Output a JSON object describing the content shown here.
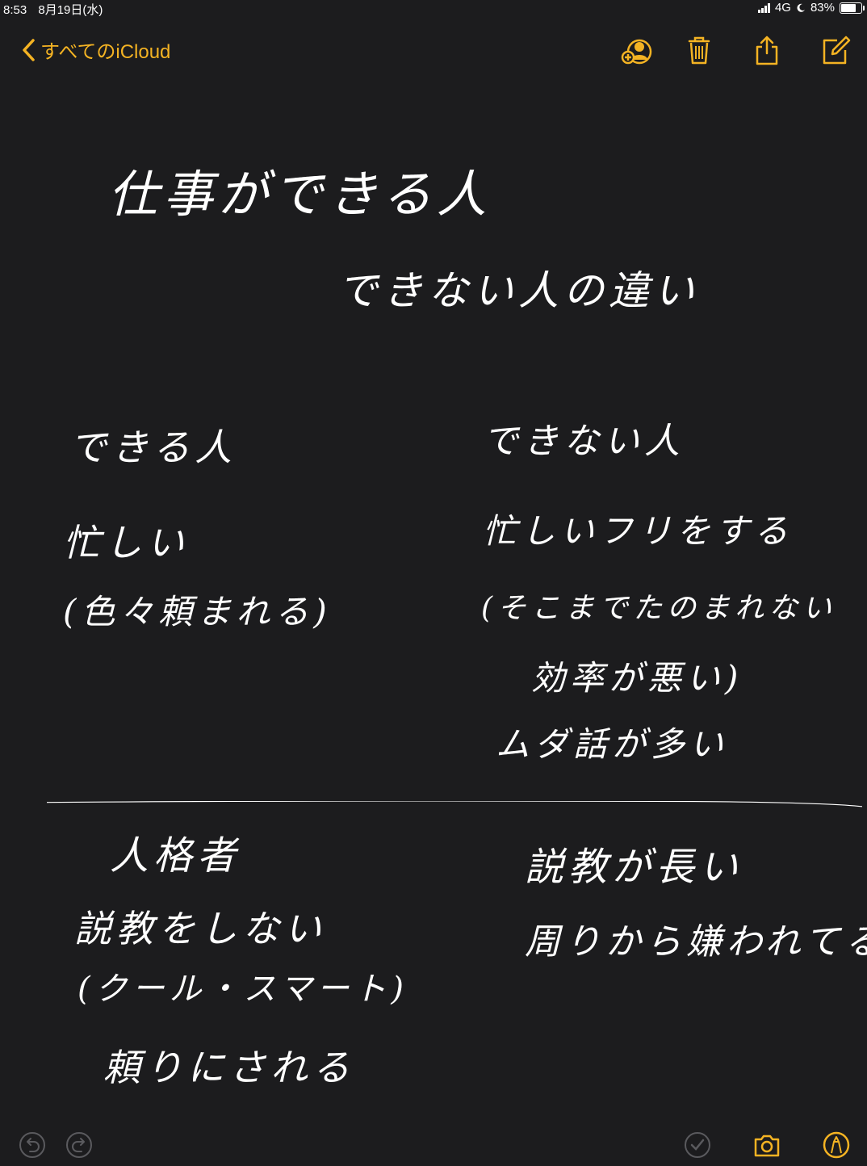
{
  "status_bar": {
    "time": "8:53",
    "date": "8月19日(水)",
    "network": "4G",
    "battery": "83%",
    "battery_level": 0.83
  },
  "nav": {
    "back_label": "すべてのiCloud",
    "accent_color": "#f4b323",
    "icons": [
      "add-person-icon",
      "trash-icon",
      "share-icon",
      "compose-icon"
    ]
  },
  "note": {
    "title_line1": "仕事ができる人",
    "title_line2": "できない人の違い",
    "left_column": {
      "heading": "できる人",
      "lines": [
        "忙しい",
        "(色々頼まれる)"
      ]
    },
    "right_column": {
      "heading": "できない人",
      "lines": [
        "忙しいフリをする",
        "(そこまでたのまれない",
        "効率が悪い)",
        "ムダ話が多い"
      ]
    },
    "lower_left": {
      "heading": "人格者",
      "lines": [
        "説教をしない",
        "(クール・スマート)",
        "頼りにされる"
      ]
    },
    "lower_right": {
      "lines": [
        "説教が長い",
        "周りから嫌われてる"
      ]
    }
  },
  "toolbar": {
    "icons": [
      "undo-icon",
      "redo-icon",
      "checklist-icon",
      "camera-icon",
      "markup-pen-icon"
    ]
  }
}
